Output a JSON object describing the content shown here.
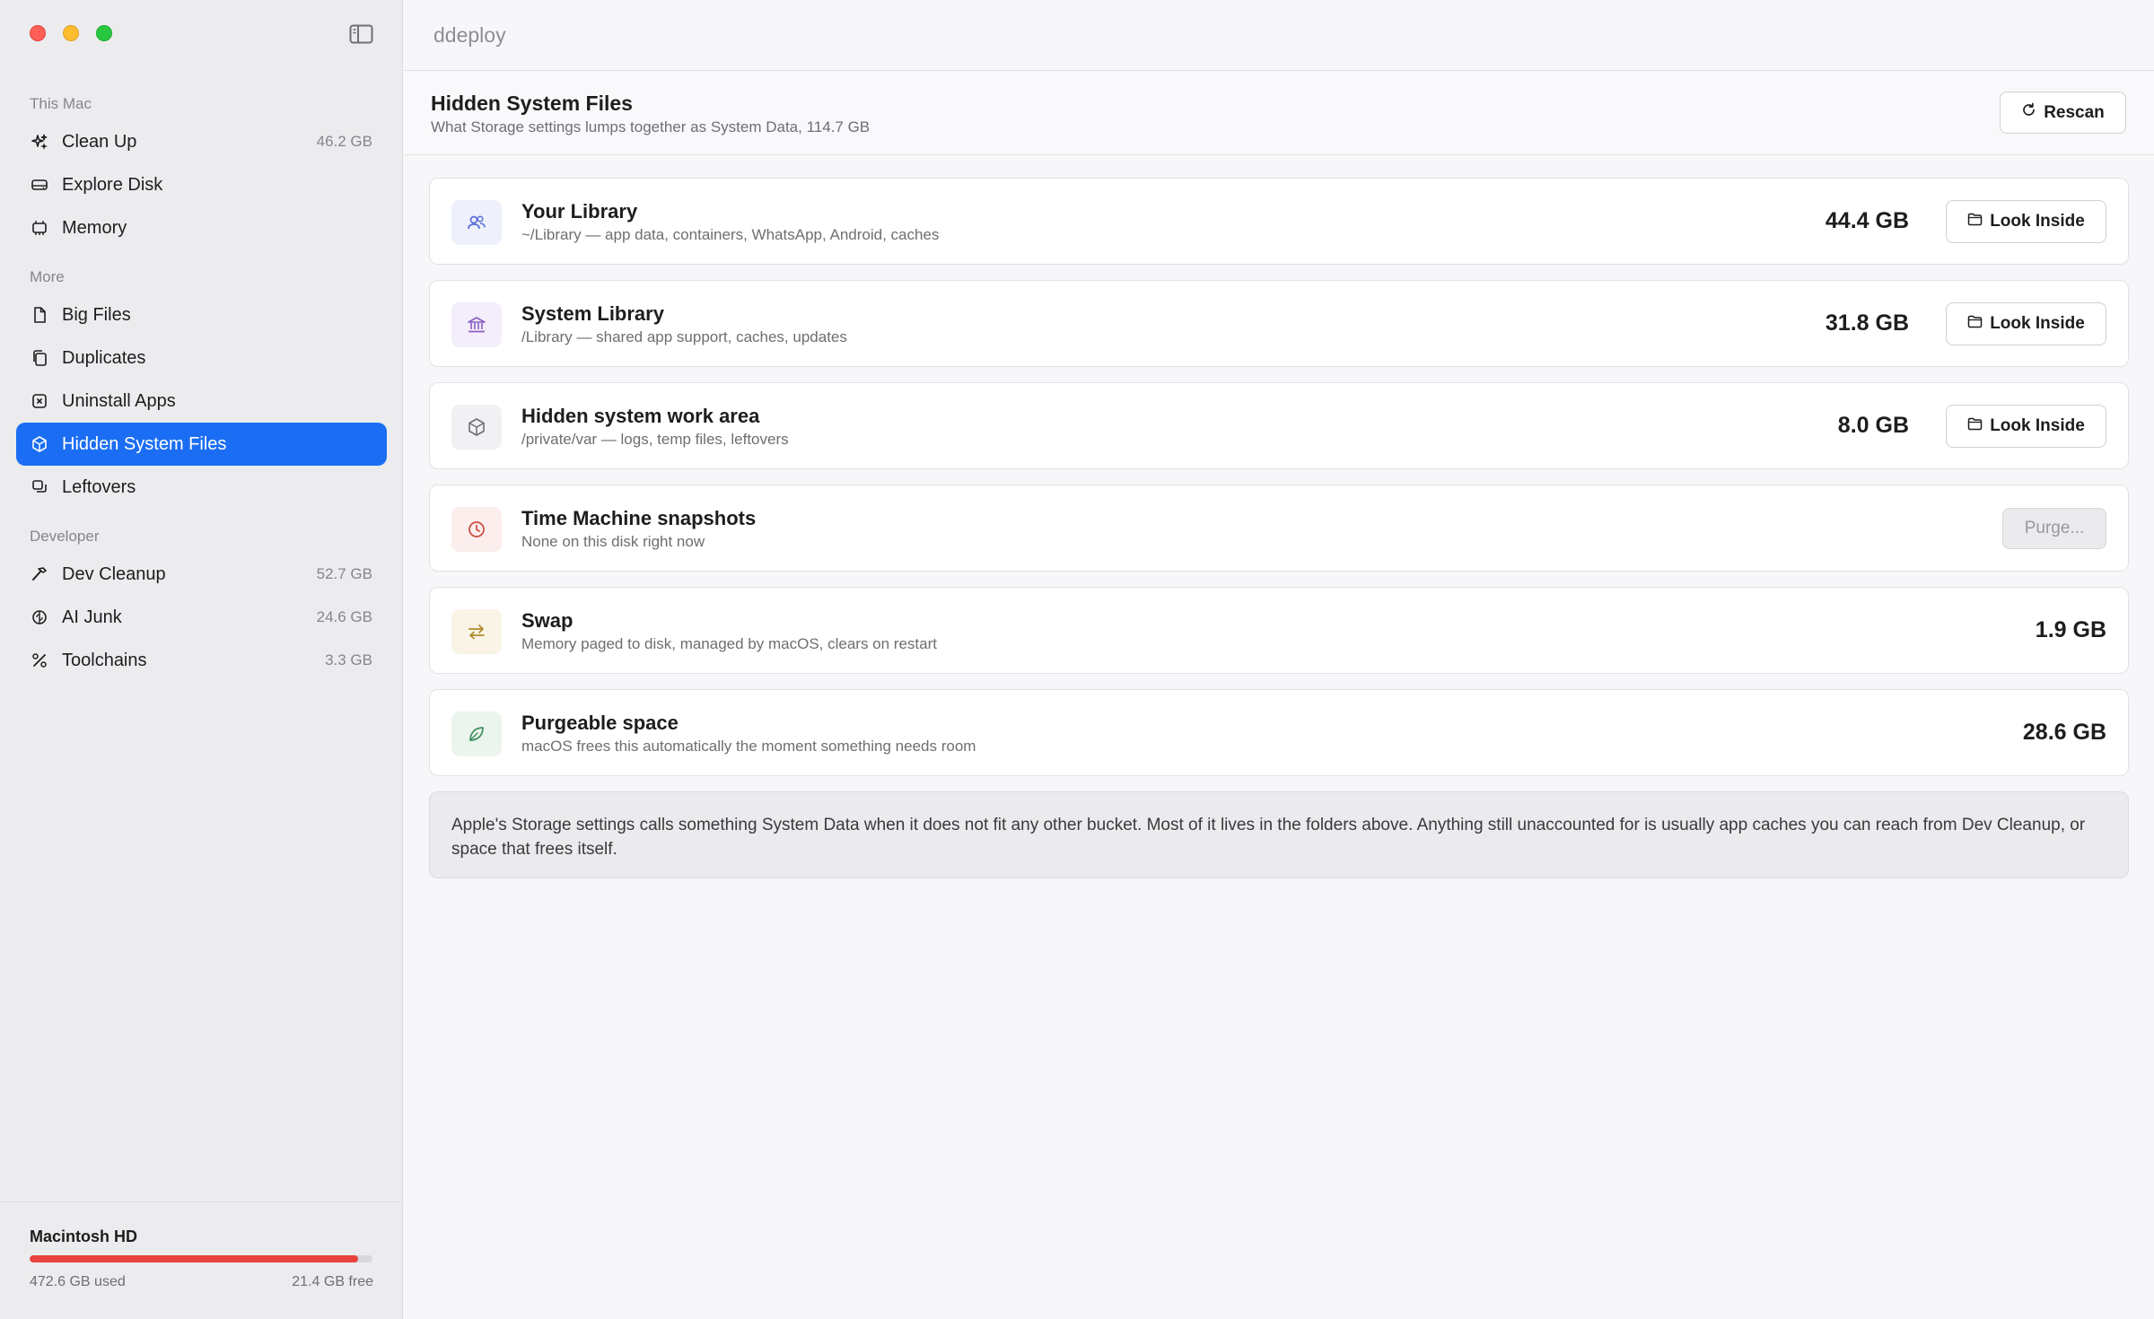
{
  "app": {
    "title": "ddeploy"
  },
  "sidebar": {
    "sections": {
      "this_mac": "This Mac",
      "more": "More",
      "developer": "Developer"
    },
    "items": [
      {
        "label": "Clean Up",
        "count": "46.2 GB",
        "icon": "sparkles-icon"
      },
      {
        "label": "Explore Disk",
        "count": "",
        "icon": "drive-icon"
      },
      {
        "label": "Memory",
        "count": "",
        "icon": "memory-chip-icon"
      },
      {
        "label": "Big Files",
        "count": "",
        "icon": "document-icon"
      },
      {
        "label": "Duplicates",
        "count": "",
        "icon": "copy-icon"
      },
      {
        "label": "Uninstall Apps",
        "count": "",
        "icon": "x-square-icon"
      },
      {
        "label": "Hidden System Files",
        "count": "",
        "icon": "cube-icon",
        "active": true
      },
      {
        "label": "Leftovers",
        "count": "",
        "icon": "stack-icon"
      },
      {
        "label": "Dev Cleanup",
        "count": "52.7 GB",
        "icon": "hammer-icon"
      },
      {
        "label": "AI Junk",
        "count": "24.6 GB",
        "icon": "brain-icon"
      },
      {
        "label": "Toolchains",
        "count": "3.3 GB",
        "icon": "wrench-icon"
      }
    ],
    "disk": {
      "name": "Macintosh HD",
      "used": "472.6 GB used",
      "free": "21.4 GB free",
      "used_fraction": 0.957,
      "bar_color": "#e8433d"
    }
  },
  "header": {
    "title": "Hidden System Files",
    "subtitle": "What Storage settings lumps together as System Data, 114.7 GB",
    "rescan_label": "Rescan"
  },
  "cards": [
    {
      "title": "Your Library",
      "subtitle": "~/Library — app data, containers, WhatsApp, Android, caches",
      "size": "44.4 GB",
      "action": "Look Inside",
      "icon": "people-icon",
      "icon_color": "#5a6fd8",
      "icon_bg": "#eef0fb"
    },
    {
      "title": "System Library",
      "subtitle": "/Library — shared app support, caches, updates",
      "size": "31.8 GB",
      "action": "Look Inside",
      "icon": "building-columns-icon",
      "icon_color": "#8a5cc7",
      "icon_bg": "#f3eefa"
    },
    {
      "title": "Hidden system work area",
      "subtitle": "/private/var — logs, temp files, leftovers",
      "size": "8.0 GB",
      "action": "Look Inside",
      "icon": "box-icon",
      "icon_color": "#6e6e73",
      "icon_bg": "#f1f1f3"
    },
    {
      "title": "Time Machine snapshots",
      "subtitle": "None on this disk right now",
      "size": "",
      "action": "Purge...",
      "icon": "clock-icon",
      "icon_color": "#c94a3c",
      "icon_bg": "#fbeeec"
    },
    {
      "title": "Swap",
      "subtitle": "Memory paged to disk, managed by macOS, clears on restart",
      "size": "1.9 GB",
      "action": "",
      "icon": "arrows-swap-icon",
      "icon_color": "#b08a2e",
      "icon_bg": "#f9f4e6"
    },
    {
      "title": "Purgeable space",
      "subtitle": "macOS frees this automatically the moment something needs room",
      "size": "28.6 GB",
      "action": "",
      "icon": "leaf-icon",
      "icon_color": "#3f8f5c",
      "icon_bg": "#ebf5ee"
    }
  ],
  "note": "Apple's Storage settings calls something System Data when it does not fit any other bucket. Most of it lives in the folders above. Anything still unaccounted for is usually app caches you can reach from Dev Cleanup, or space that frees itself."
}
